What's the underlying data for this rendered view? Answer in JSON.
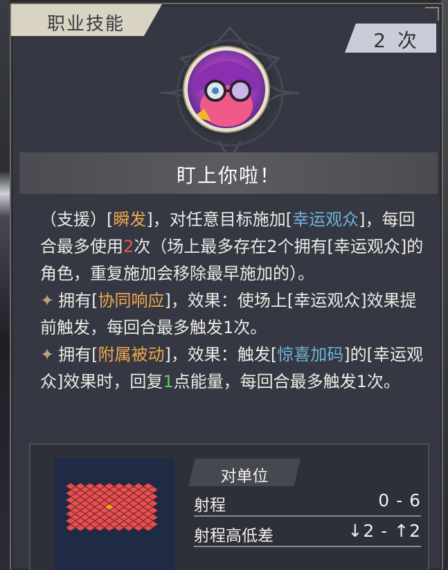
{
  "header": {
    "section_title": "职业技能",
    "uses_count": "2 次"
  },
  "skill": {
    "name": "盯上你啦！",
    "description": {
      "p1_a": "（支援）[",
      "p1_kw1": "瞬发",
      "p1_b": "]，对任意目标施加[",
      "p1_kw2": "幸运观众",
      "p1_c": "]，每回合最多使用",
      "p1_num": "2",
      "p1_d": "次（场上最多存在2个拥有[幸运观众]的角色，重复施加会移除最早施加的）。",
      "p2_a": "拥有[",
      "p2_kw": "协同响应",
      "p2_b": "]，效果：使场上[幸运观众]效果提前触发，每回合最多触发1次。",
      "p3_a": "拥有[",
      "p3_kw1": "附属被动",
      "p3_b": "]，效果：触发[",
      "p3_kw2": "惊喜加码",
      "p3_c": "]的[幸运观众]效果时，回复",
      "p3_num": "1",
      "p3_d": "点能量，每回合最多触发1次。"
    }
  },
  "stats": {
    "target_type": "对单位",
    "range_label": "射程",
    "range_value": "0 - 6",
    "height_label": "射程高低差",
    "height_value": "↓2 - ↑2"
  },
  "colors": {
    "keyword_orange": "#f0a850",
    "keyword_blue": "#6fb4d8",
    "number_red": "#e25a4a",
    "number_green": "#5fd060",
    "range_tile": "#e85050",
    "center_tile": "#f0a020"
  },
  "icons": {
    "sparkle": "✦",
    "skill_portrait": "purple-glasses-portrait"
  }
}
